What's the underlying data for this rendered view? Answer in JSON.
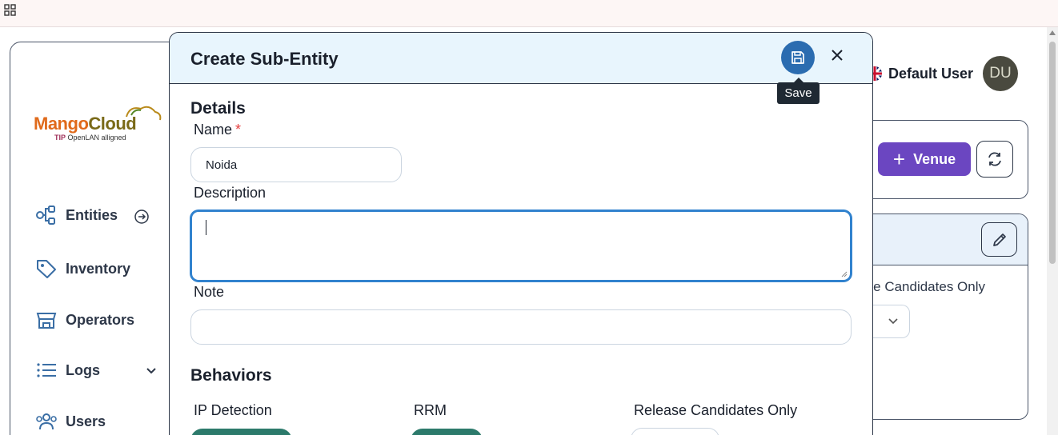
{
  "app": {
    "logo_main": "Mango",
    "logo_cloud": "Cloud",
    "logo_tip": "TIP",
    "logo_sub": " OpenLAN alligned"
  },
  "sidebar": {
    "items": [
      {
        "label": "Entities",
        "icon": "entities-icon"
      },
      {
        "label": "Inventory",
        "icon": "tag-icon"
      },
      {
        "label": "Operators",
        "icon": "store-icon"
      },
      {
        "label": "Logs",
        "icon": "list-icon"
      },
      {
        "label": "Users",
        "icon": "users-icon"
      }
    ]
  },
  "header": {
    "user_name": "Default User",
    "avatar_initials": "DU"
  },
  "background": {
    "venue_button_label": "Venue",
    "release_candidates_text": "Release Candidates Only"
  },
  "modal": {
    "title": "Create Sub-Entity",
    "save_tooltip": "Save",
    "details_title": "Details",
    "name_label": "Name",
    "name_required_mark": "*",
    "name_value": "Noida",
    "description_label": "Description",
    "description_value": "",
    "note_label": "Note",
    "note_value": "",
    "behaviors_title": "Behaviors",
    "behaviors": [
      {
        "label": "IP Detection"
      },
      {
        "label": "RRM"
      },
      {
        "label": "Release Candidates Only"
      }
    ]
  },
  "colors": {
    "save_button": "#2b6cb0",
    "modal_header": "#e8f5fd",
    "focus_ring": "#3182ce",
    "venue_button": "#6b46c1",
    "toggle_green": "#2c7a6b",
    "required": "#e53e3e"
  }
}
